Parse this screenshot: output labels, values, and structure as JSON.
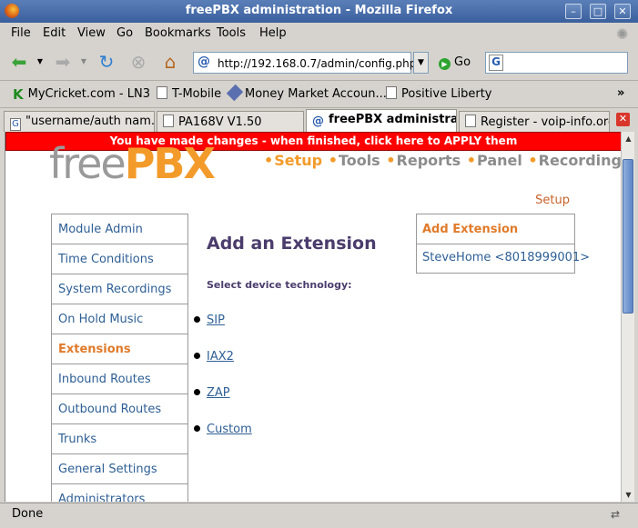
{
  "window": {
    "title": "freePBX administration - Mozilla Firefox",
    "min_label": "–",
    "max_label": "□",
    "close_label": "✕"
  },
  "menu": {
    "file": "File",
    "edit": "Edit",
    "view": "View",
    "go": "Go",
    "bookmarks": "Bookmarks",
    "tools": "Tools",
    "help": "Help"
  },
  "nav": {
    "url": "http://192.168.0.7/admin/config.php",
    "go_label": "Go",
    "search_placeholder": ""
  },
  "bookmarks": [
    {
      "label": "MyCricket.com - LN3"
    },
    {
      "label": "T-Mobile"
    },
    {
      "label": "Money Market Accoun..."
    },
    {
      "label": "Positive Liberty"
    }
  ],
  "tabs": [
    {
      "label": "\"username/auth nam..."
    },
    {
      "label": "PA168V V1.50"
    },
    {
      "label": "freePBX administra..."
    },
    {
      "label": "Register - voip-info.org"
    }
  ],
  "page": {
    "apply_banner": "You have made changes - when finished, click here to APPLY them",
    "logo_free": "free",
    "logo_pbx": "PBX",
    "topnav": [
      "Setup",
      "Tools",
      "Reports",
      "Panel",
      "Recordings"
    ],
    "breadcrumb": "Setup",
    "sidebar": [
      "Module Admin",
      "Time Conditions",
      "System Recordings",
      "On Hold Music",
      "Extensions",
      "Inbound Routes",
      "Outbound Routes",
      "Trunks",
      "General Settings",
      "Administrators"
    ],
    "heading": "Add an Extension",
    "select_label": "Select device technology:",
    "technologies": [
      "SIP",
      "IAX2",
      "ZAP",
      "Custom"
    ],
    "right_box": {
      "header": "Add Extension",
      "items": [
        "SteveHome <8018999001>"
      ]
    }
  },
  "status": {
    "text": "Done"
  },
  "colors": {
    "apply_banner": "#ff0000",
    "accent_orange": "#f39b2a",
    "link_blue": "#2e5f95",
    "heading_purple": "#4a3c6c"
  }
}
